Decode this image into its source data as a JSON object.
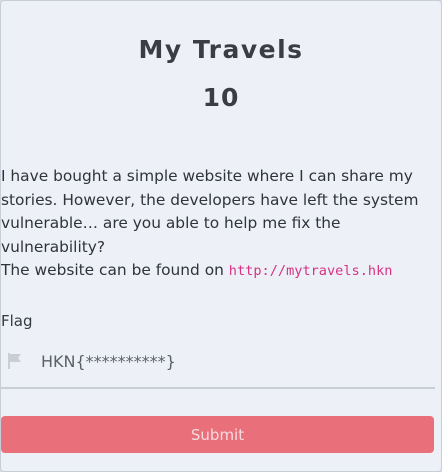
{
  "challenge": {
    "title": "My Travels",
    "points": "10",
    "description_lines": [
      "I have bought a simple website where I can share my",
      "stories. However, the developers have left the system",
      "vulnerable… are you able to help me fix the vulnerability?"
    ],
    "description_last_prefix": "The website can be found on ",
    "url": "http://mytravels.hkn"
  },
  "form": {
    "flag_label": "Flag",
    "flag_placeholder": "HKN{**********}",
    "submit_label": "Submit"
  },
  "colors": {
    "background": "#edf1f7",
    "submit_button": "#e9707a",
    "url_text": "#d63384"
  },
  "icons": {
    "flag_input": "flag-icon"
  }
}
